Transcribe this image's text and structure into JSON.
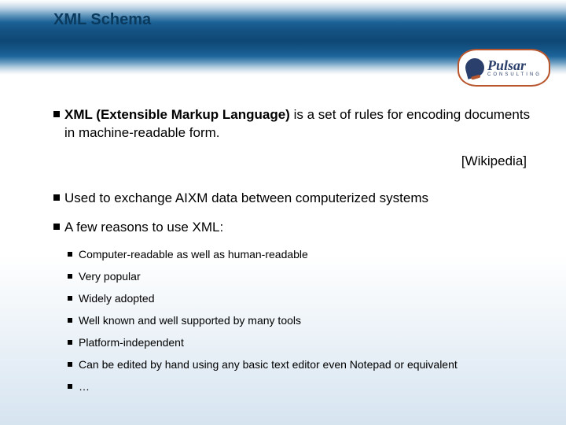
{
  "title": "XML Schema",
  "logo": {
    "name": "Pulsar",
    "subtitle": "CONSULTING"
  },
  "intro": {
    "bold": "XML (Extensible Markup Language)",
    "rest": " is a set of rules for encoding documents in machine-readable form."
  },
  "citation": "[Wikipedia]",
  "point_exchange": "Used to exchange AIXM data between computerized systems",
  "point_reasons": "A few reasons to use XML:",
  "reasons": [
    "Computer-readable as well as human-readable",
    "Very popular",
    "Widely adopted",
    "Well known and well supported by many tools",
    "Platform-independent",
    "Can be edited by hand using any basic text editor even Notepad or equivalent",
    "…"
  ]
}
